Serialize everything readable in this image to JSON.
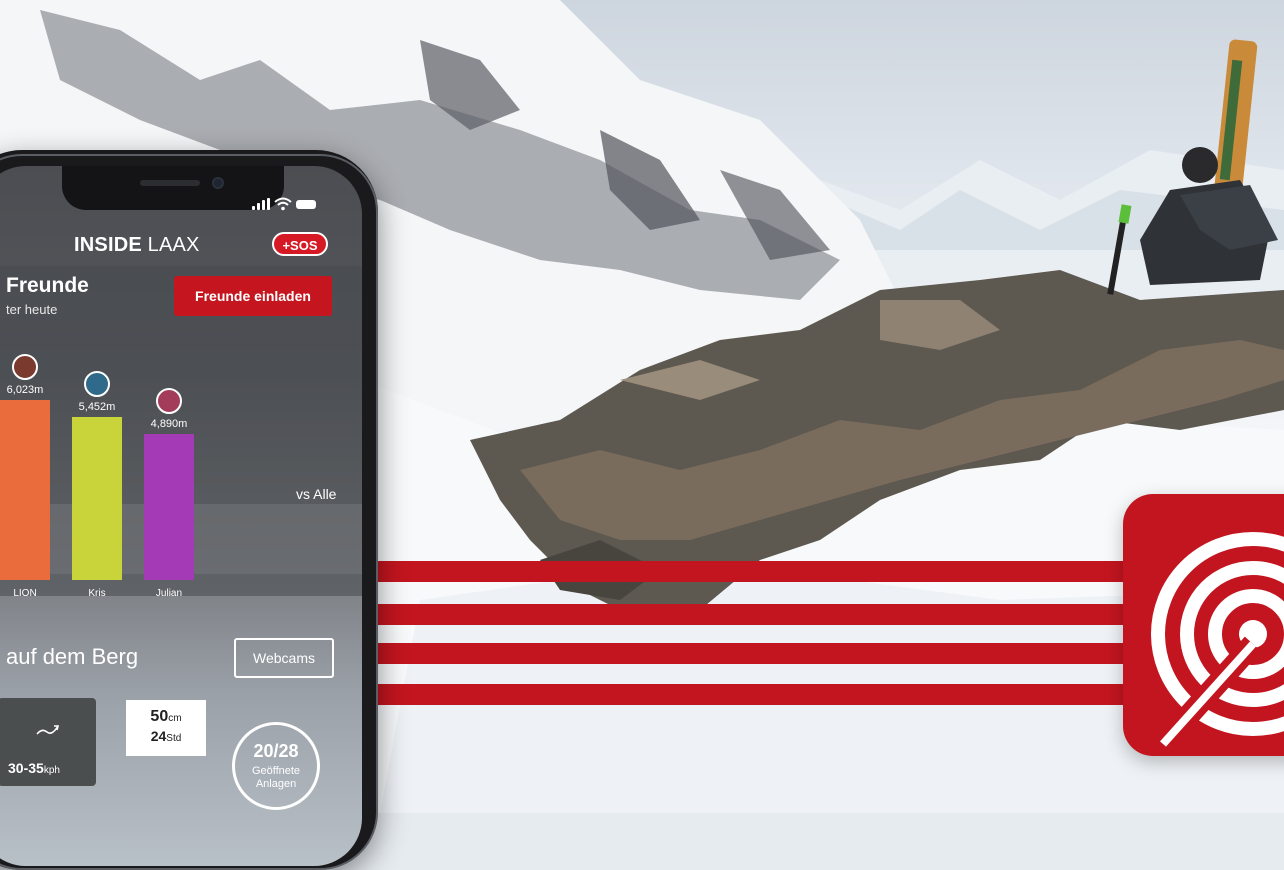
{
  "app": {
    "brand_bold": "INSIDE",
    "brand_light": "LAAX",
    "sos_label": "+SOS"
  },
  "friends": {
    "title": "Freunde",
    "subtitle": "ter heute",
    "invite_label": "Freunde einladen",
    "compare_label": "vs Alle",
    "leaderboard": [
      {
        "name": "LION",
        "value_label": "6,023m",
        "value_m": 6023,
        "color": "#ea6b3c"
      },
      {
        "name": "Kris",
        "value_label": "5,452m",
        "value_m": 5452,
        "color": "#c9d43a"
      },
      {
        "name": "Julian",
        "value_label": "4,890m",
        "value_m": 4890,
        "color": "#a43ab6"
      }
    ]
  },
  "mountain": {
    "title": "auf dem Berg",
    "webcams_label": "Webcams",
    "wind": {
      "value": "30-35",
      "unit": "kph",
      "icon": "wind-icon"
    },
    "snow": {
      "line1_value": "50",
      "line1_unit": "cm",
      "line2_value": "24",
      "line2_unit": "Std"
    },
    "lifts": {
      "count": "20/28",
      "label": "Geöffnete Anlagen"
    }
  },
  "colors": {
    "brand_red": "#c3151f",
    "panel_dark": "#46484d"
  }
}
